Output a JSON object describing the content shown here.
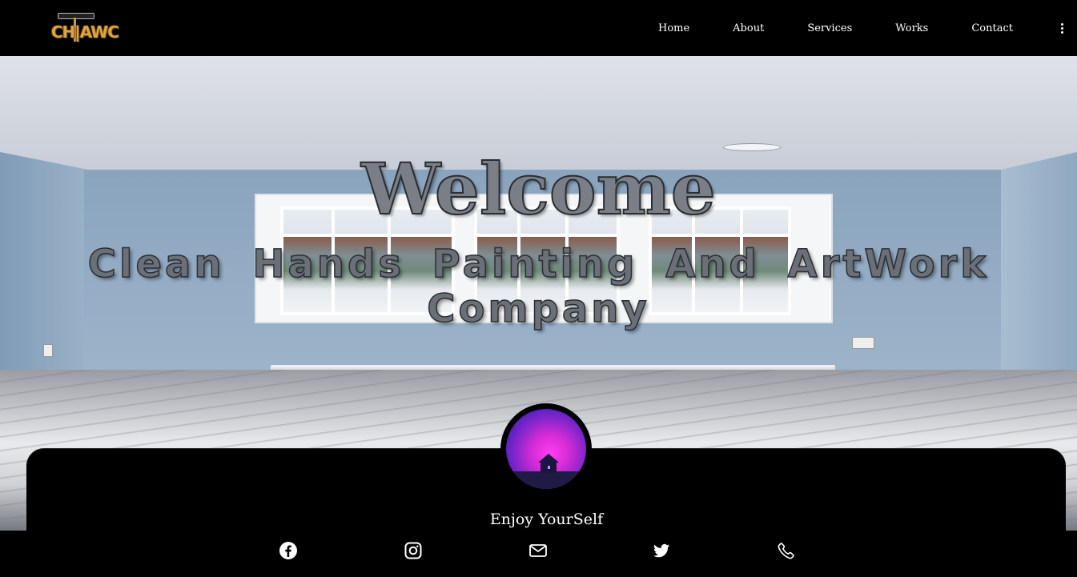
{
  "header": {
    "logo_text": "CH|AWC",
    "nav": [
      "Home",
      "About",
      "Services",
      "Works",
      "Contact"
    ],
    "menu_icon": "kebab-menu-icon"
  },
  "hero": {
    "title": "Welcome",
    "subtitle": "Clean Hands Painting And ArtWork Company"
  },
  "profile": {
    "avatar_icon": "profile-avatar",
    "tagline": "Enjoy YourSelf",
    "socials": [
      "facebook-icon",
      "instagram-icon",
      "mail-icon",
      "twitter-icon",
      "phone-icon"
    ]
  },
  "colors": {
    "header_bg": "#000000",
    "logo_gold": "#d9a441",
    "nav_text": "#ffffff",
    "card_bg": "#000000",
    "avatar_accent": "#ff3df2"
  }
}
